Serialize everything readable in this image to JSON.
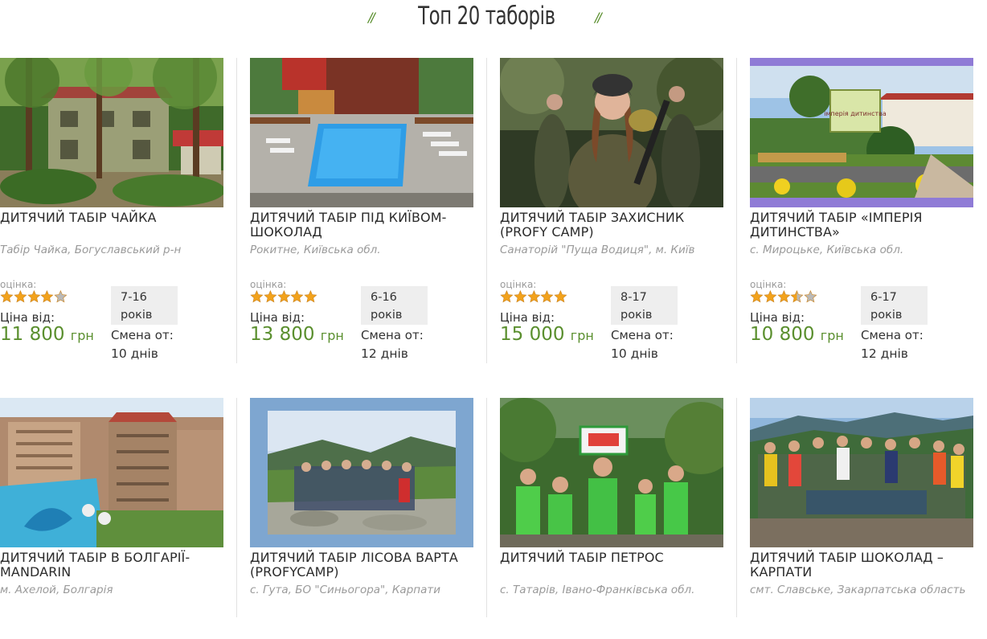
{
  "header": {
    "title": "Топ 20 таборів",
    "ornament_left": "//",
    "ornament_right": "//"
  },
  "colors": {
    "accent": "#5a8f2e",
    "star": "#f2a21c",
    "star_empty": "#b9b9b9"
  },
  "camps": [
    {
      "name": "ДИТЯЧИЙ ТАБІР ЧАЙКА",
      "location": "Табір Чайка, Богуславський р-н",
      "rating_label": "оцінка:",
      "rating": 4,
      "age_line1": "7-16",
      "age_line2": "років",
      "price_label": "Ціна від:",
      "price": "11 800",
      "currency": "грн",
      "shift_label": "Смена от:",
      "shift": "10 днів",
      "photo": "forest-cottage-photo"
    },
    {
      "name": "ДИТЯЧИЙ ТАБІР ПІД КИЇВОМ-ШОКОЛАД",
      "location": "Рокитне, Київська обл.",
      "rating_label": "оцінка:",
      "rating": 5,
      "age_line1": "6-16",
      "age_line2": "років",
      "price_label": "Ціна від:",
      "price": "13 800",
      "currency": "грн",
      "shift_label": "Смена от:",
      "shift": "12 днів",
      "photo": "swimming-pool-photo"
    },
    {
      "name": "ДИТЯЧИЙ ТАБІР ЗАХИСНИК (PROFY CAMP)",
      "location": "Санаторій \"Пуща Водиця\", м. Київ",
      "rating_label": "оцінка:",
      "rating": 5,
      "age_line1": "8-17",
      "age_line2": "років",
      "price_label": "Ціна від:",
      "price": "15 000",
      "currency": "грн",
      "shift_label": "Смена от:",
      "shift": "10 днів",
      "photo": "paintball-girl-photo"
    },
    {
      "name": "ДИТЯЧИЙ ТАБІР «ІМПЕРІЯ ДИТИНСТВА»",
      "location": "с. Мироцьке, Київська обл.",
      "rating_label": "оцінка:",
      "rating": 3.5,
      "age_line1": "6-17",
      "age_line2": "років",
      "price_label": "Ціна від:",
      "price": "10 800",
      "currency": "грн",
      "shift_label": "Смена от:",
      "shift": "12 днів",
      "photo": "camp-entrance-sign-photo",
      "photo_sign": "імперія дитинства"
    },
    {
      "name": "ДИТЯЧИЙ ТАБІР В БОЛГАРІЇ-MANDARIN",
      "location": "м. Ахелой, Болгарія",
      "photo": "resort-buildings-photo"
    },
    {
      "name": "ДИТЯЧИЙ ТАБІР ЛІСОВА ВАРТА (PROFYCAMP)",
      "location": "с. Гута, БО \"Синьогора\", Карпати",
      "photo": "mountain-group-photo"
    },
    {
      "name": "ДИТЯЧИЙ ТАБІР ПЕТРОС",
      "location": "с. Татарів, Івано-Франківська обл.",
      "photo": "kids-green-shirts-photo"
    },
    {
      "name": "ДИТЯЧИЙ ТАБІР ШОКОЛАД – КАРПАТИ",
      "location": "смт. Славське, Закарпатська область",
      "photo": "mountain-teens-photo"
    }
  ]
}
